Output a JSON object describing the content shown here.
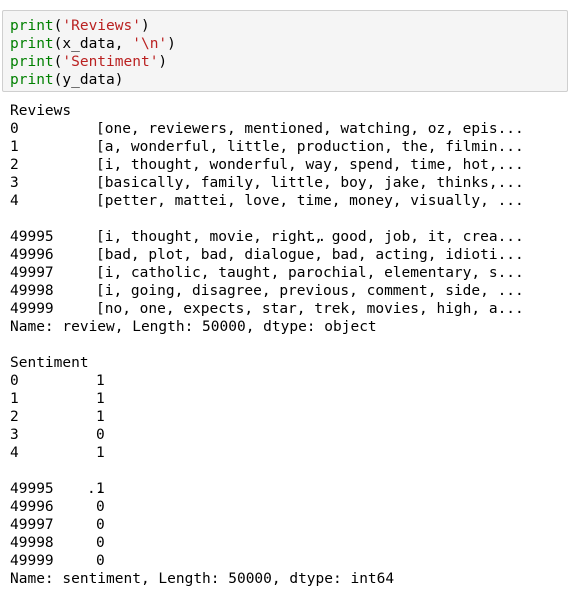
{
  "code_cell": {
    "lines": [
      {
        "fn": "print",
        "open": "(",
        "args": [
          {
            "type": "str",
            "text": "'Reviews'"
          }
        ],
        "close": ")"
      },
      {
        "fn": "print",
        "open": "(",
        "args": [
          {
            "type": "plain",
            "text": "x_data, "
          },
          {
            "type": "str",
            "text": "'\\n'"
          }
        ],
        "close": ")"
      },
      {
        "fn": "print",
        "open": "(",
        "args": [
          {
            "type": "str",
            "text": "'Sentiment'"
          }
        ],
        "close": ")"
      },
      {
        "fn": "print",
        "open": "(",
        "args": [
          {
            "type": "plain",
            "text": "y_data"
          }
        ],
        "close": ")"
      }
    ]
  },
  "output": {
    "reviews_header": "Reviews",
    "reviews_rows_top": [
      {
        "index": "0",
        "value": "[one, reviewers, mentioned, watching, oz, epis..."
      },
      {
        "index": "1",
        "value": "[a, wonderful, little, production, the, filmin..."
      },
      {
        "index": "2",
        "value": "[i, thought, wonderful, way, spend, time, hot,..."
      },
      {
        "index": "3",
        "value": "[basically, family, little, boy, jake, thinks,..."
      },
      {
        "index": "4",
        "value": "[petter, mattei, love, time, money, visually, ..."
      }
    ],
    "reviews_ellipsis": "...",
    "reviews_rows_bottom": [
      {
        "index": "49995",
        "value": "[i, thought, movie, right, good, job, it, crea..."
      },
      {
        "index": "49996",
        "value": "[bad, plot, bad, dialogue, bad, acting, idioti..."
      },
      {
        "index": "49997",
        "value": "[i, catholic, taught, parochial, elementary, s..."
      },
      {
        "index": "49998",
        "value": "[i, going, disagree, previous, comment, side, ..."
      },
      {
        "index": "49999",
        "value": "[no, one, expects, star, trek, movies, high, a..."
      }
    ],
    "reviews_footer": "Name: review, Length: 50000, dtype: object",
    "sentiment_header": "Sentiment",
    "sentiment_rows_top": [
      {
        "index": "0",
        "value": "1"
      },
      {
        "index": "1",
        "value": "1"
      },
      {
        "index": "2",
        "value": "1"
      },
      {
        "index": "3",
        "value": "0"
      },
      {
        "index": "4",
        "value": "1"
      }
    ],
    "sentiment_ellipsis": "..",
    "sentiment_rows_bottom": [
      {
        "index": "49995",
        "value": "1"
      },
      {
        "index": "49996",
        "value": "0"
      },
      {
        "index": "49997",
        "value": "0"
      },
      {
        "index": "49998",
        "value": "0"
      },
      {
        "index": "49999",
        "value": "0"
      }
    ],
    "sentiment_footer": "Name: sentiment, Length: 50000, dtype: int64"
  }
}
